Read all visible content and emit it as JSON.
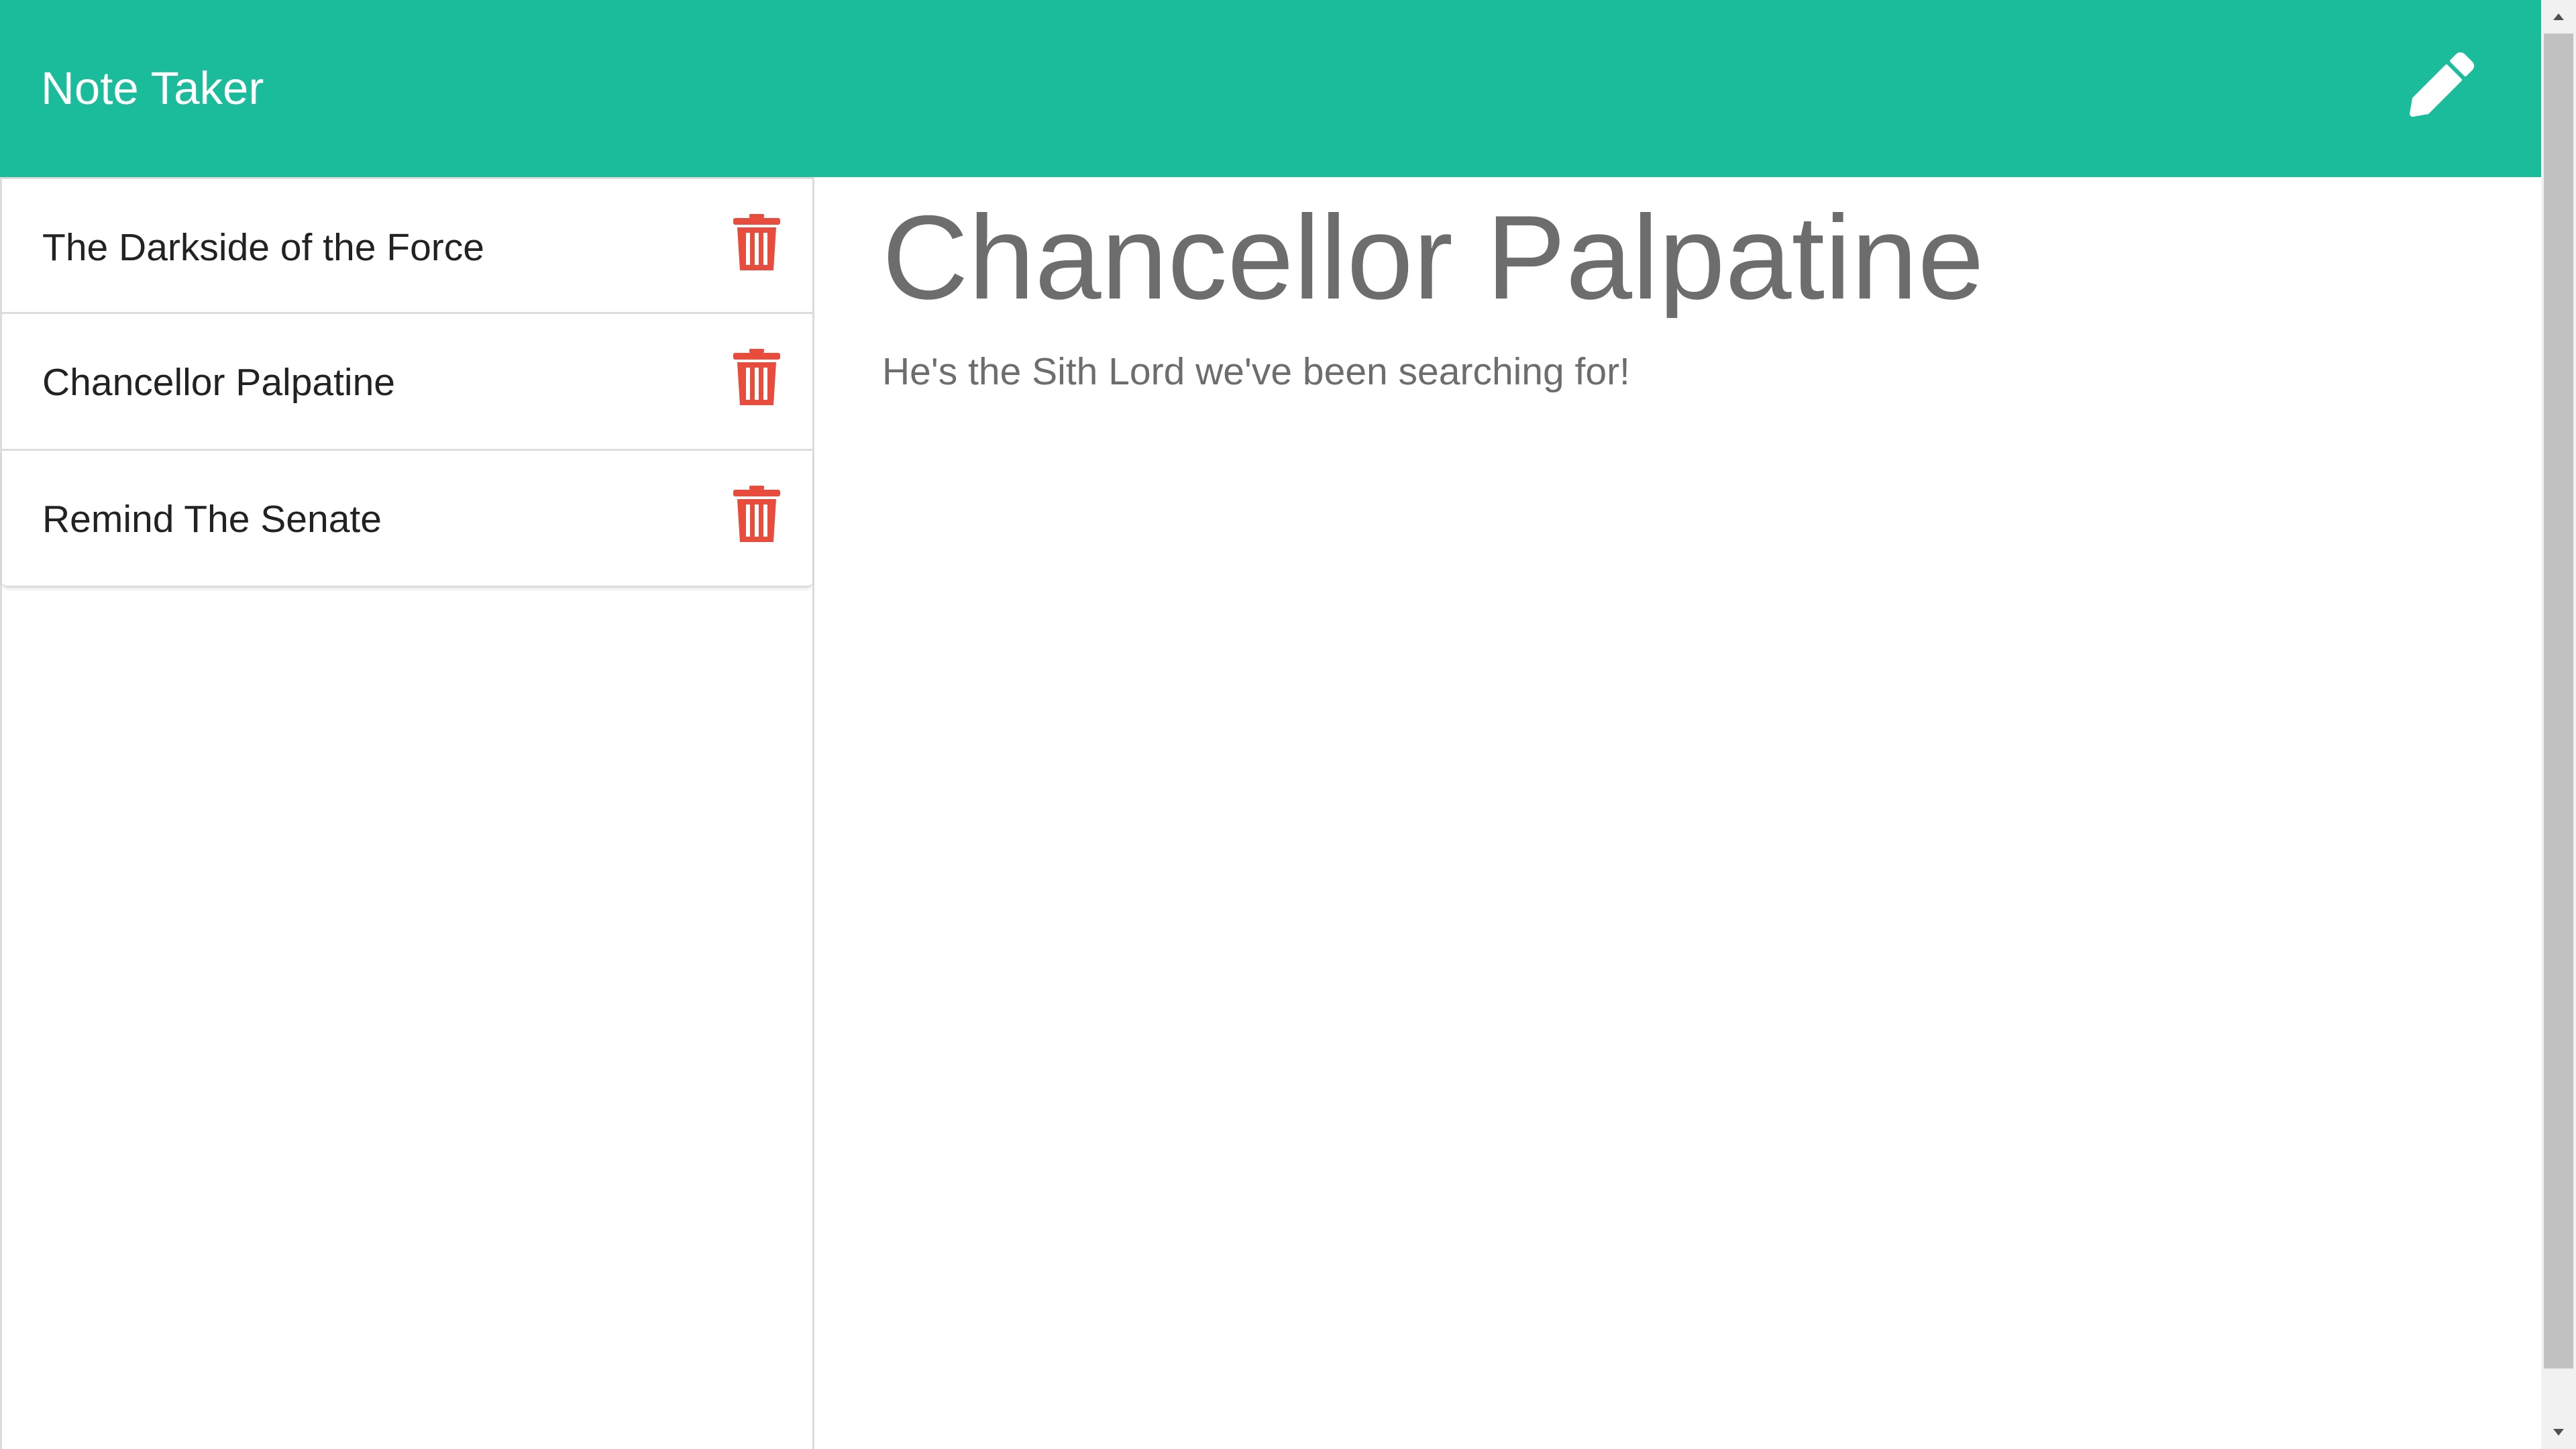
{
  "app": {
    "title": "Note Taker"
  },
  "header": {
    "new_note_icon": "pencil-icon"
  },
  "notes": [
    {
      "title": "The Darkside of the Force",
      "delete_icon": "trash-icon"
    },
    {
      "title": "Chancellor Palpatine",
      "delete_icon": "trash-icon"
    },
    {
      "title": "Remind The Senate",
      "delete_icon": "trash-icon"
    }
  ],
  "active_note": {
    "title": "Chancellor Palpatine",
    "text": "He's the Sith Lord we've been searching for!"
  },
  "colors": {
    "header": "#1abc9c",
    "delete": "#e74c3c",
    "note_text": "#6d6d6d"
  }
}
